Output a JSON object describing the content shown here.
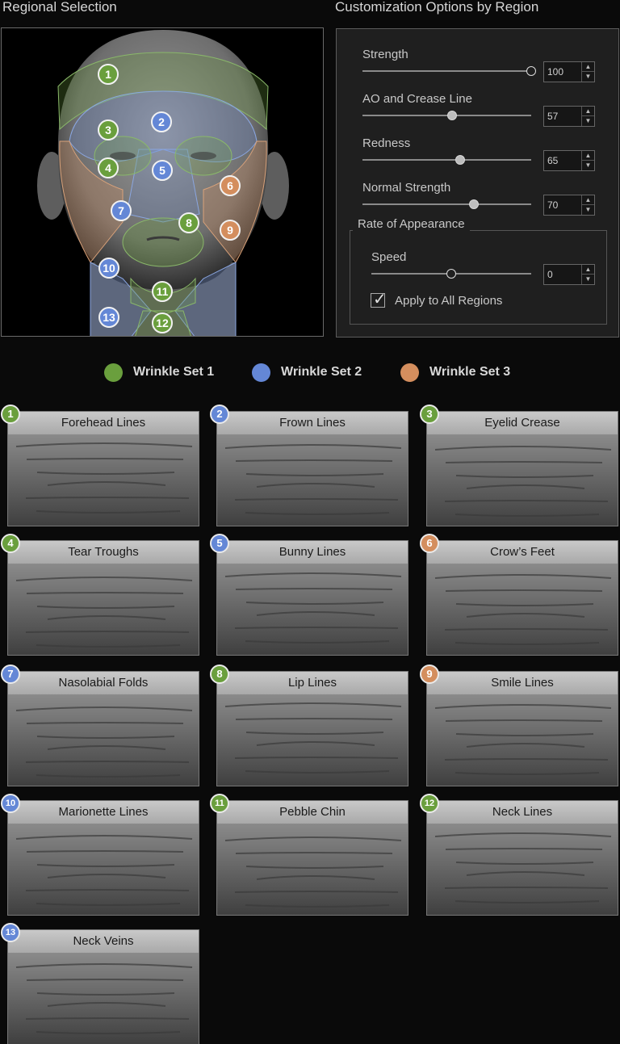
{
  "headers": {
    "regional_selection": "Regional Selection",
    "customization": "Customization Options by Region"
  },
  "colors": {
    "set1": "#6a9f3d",
    "set2": "#6487d6",
    "set3": "#d48e5e"
  },
  "region_badges": [
    "1",
    "2",
    "3",
    "4",
    "5",
    "6",
    "7",
    "8",
    "9",
    "10",
    "11",
    "12",
    "13"
  ],
  "options": {
    "strength": {
      "label": "Strength",
      "value": "100",
      "slider_fraction": 1.0
    },
    "ao": {
      "label": "AO and Crease Line",
      "value": "57",
      "slider_fraction": 0.53
    },
    "redness": {
      "label": "Redness",
      "value": "65",
      "slider_fraction": 0.58
    },
    "normal": {
      "label": "Normal Strength",
      "value": "70",
      "slider_fraction": 0.66
    },
    "rate_group": "Rate of Appearance",
    "speed": {
      "label": "Speed",
      "value": "0",
      "slider_fraction": 0.5
    },
    "apply_all": {
      "label": "Apply to All Regions",
      "checked": true
    }
  },
  "legend": [
    {
      "label": "Wrinkle Set 1",
      "color": "#6a9f3d"
    },
    {
      "label": "Wrinkle Set 2",
      "color": "#6487d6"
    },
    {
      "label": "Wrinkle Set 3",
      "color": "#d48e5e"
    }
  ],
  "tiles": [
    {
      "num": "1",
      "title": "Forehead Lines",
      "set": "set1"
    },
    {
      "num": "2",
      "title": "Frown Lines",
      "set": "set2"
    },
    {
      "num": "3",
      "title": "Eyelid Crease",
      "set": "set1"
    },
    {
      "num": "4",
      "title": "Tear Troughs",
      "set": "set1"
    },
    {
      "num": "5",
      "title": "Bunny Lines",
      "set": "set2"
    },
    {
      "num": "6",
      "title": "Crow’s Feet",
      "set": "set3"
    },
    {
      "num": "7",
      "title": "Nasolabial Folds",
      "set": "set2"
    },
    {
      "num": "8",
      "title": "Lip Lines",
      "set": "set1"
    },
    {
      "num": "9",
      "title": "Smile Lines",
      "set": "set3"
    },
    {
      "num": "10",
      "title": "Marionette Lines",
      "set": "set2"
    },
    {
      "num": "11",
      "title": "Pebble Chin",
      "set": "set1"
    },
    {
      "num": "12",
      "title": "Neck Lines",
      "set": "set1"
    },
    {
      "num": "13",
      "title": "Neck Veins",
      "set": "set2"
    }
  ]
}
